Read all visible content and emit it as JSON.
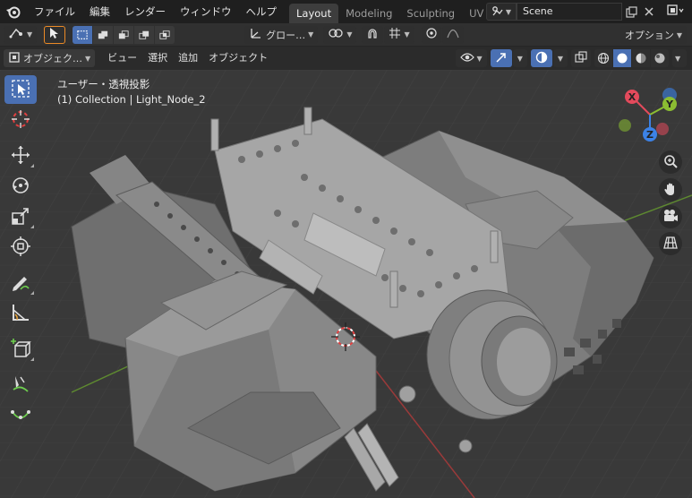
{
  "menubar": {
    "items": [
      "ファイル",
      "編集",
      "レンダー",
      "ウィンドウ",
      "ヘルプ"
    ],
    "workspaces": [
      {
        "label": "Layout",
        "active": true
      },
      {
        "label": "Modeling",
        "active": false
      },
      {
        "label": "Sculpting",
        "active": false
      },
      {
        "label": "UV Ed",
        "active": false
      }
    ],
    "scene_name": "Scene"
  },
  "header1": {
    "transform_orientation": "グロー…",
    "options_label": "オプション"
  },
  "header2": {
    "mode_label": "オブジェク…",
    "menus": [
      "ビュー",
      "選択",
      "追加",
      "オブジェクト"
    ]
  },
  "viewport": {
    "title": "ユーザー・透視投影",
    "subtitle": "(1) Collection | Light_Node_2",
    "gizmo_axes": [
      "X",
      "Y",
      "Z"
    ]
  },
  "icons": {
    "tools": [
      "select-box-icon",
      "cursor-icon",
      "move-icon",
      "rotate-icon",
      "scale-icon",
      "transform-icon",
      "annotate-icon",
      "measure-icon",
      "add-cube-icon",
      "brush-icon",
      "curve-icon"
    ],
    "nav": [
      "zoom-icon",
      "hand-icon",
      "camera-icon",
      "grid-icon"
    ]
  },
  "colors": {
    "accent": "#4a70b3",
    "x_axis": "#e34a5c",
    "y_axis": "#8bbd32",
    "z_axis": "#3c82e6",
    "viewport_bg": "#393939"
  }
}
